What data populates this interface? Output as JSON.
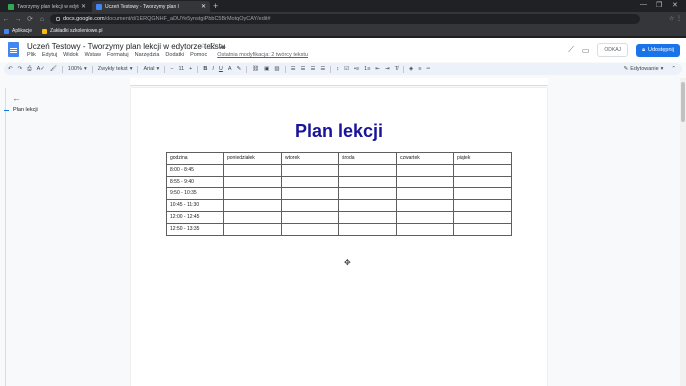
{
  "browser": {
    "tabs": [
      {
        "title": "Tworzymy plan lekcji w edytorze",
        "favicon_color": "#34a853",
        "active": false
      },
      {
        "title": "Uczeń Testowy - Tworzymy plan l",
        "favicon_color": "#4285f4",
        "active": true
      }
    ],
    "new_tab": "+",
    "url_host": "docs.google.com",
    "url_path": "/document/d/1ERQGNHF_aDUYe5ynstgiPbbC5BrMotqOyCAY/edit#",
    "bookmarks": [
      {
        "label": "Aplikacje",
        "color": "#4285f4"
      },
      {
        "label": "Zakładki szkoleniowe.pl",
        "color": "#fbbc04"
      }
    ]
  },
  "docs": {
    "title": "Uczeń Testowy - Tworzymy plan lekcji w edytorze tekstu",
    "menu": [
      "Plik",
      "Edytuj",
      "Widok",
      "Wstaw",
      "Formatuj",
      "Narzędzia",
      "Dodatki",
      "Pomoc"
    ],
    "last_edit": "Ostatnia modyfikacja: 2 twórcy tekstu",
    "share_label": "Udostępnij",
    "comment_label": "ODKAJ",
    "toolbar": {
      "zoom": "100%",
      "style": "Zwykły tekst",
      "font": "Arial",
      "size": "11",
      "mode": "Edytowanie"
    },
    "outline_item": "Plan lekcji",
    "page_title": "Plan lekcji",
    "table": {
      "headers": [
        "godzina",
        "poniedziałek",
        "wtorek",
        "środa",
        "czwartek",
        "piątek"
      ],
      "rows": [
        [
          "8:00 - 8:45",
          "",
          "",
          "",
          "",
          ""
        ],
        [
          "8:55 - 9:40",
          "",
          "",
          "",
          "",
          ""
        ],
        [
          "9:50 - 10:35",
          "",
          "",
          "",
          "",
          ""
        ],
        [
          "10:45 - 11:30",
          "",
          "",
          "",
          "",
          ""
        ],
        [
          "12:00 - 12:45",
          "",
          "",
          "",
          "",
          ""
        ],
        [
          "12:50 - 13:35",
          "",
          "",
          "",
          "",
          ""
        ]
      ]
    }
  },
  "colors": {
    "title": "#1b1499",
    "share_button": "#1a73e8"
  }
}
